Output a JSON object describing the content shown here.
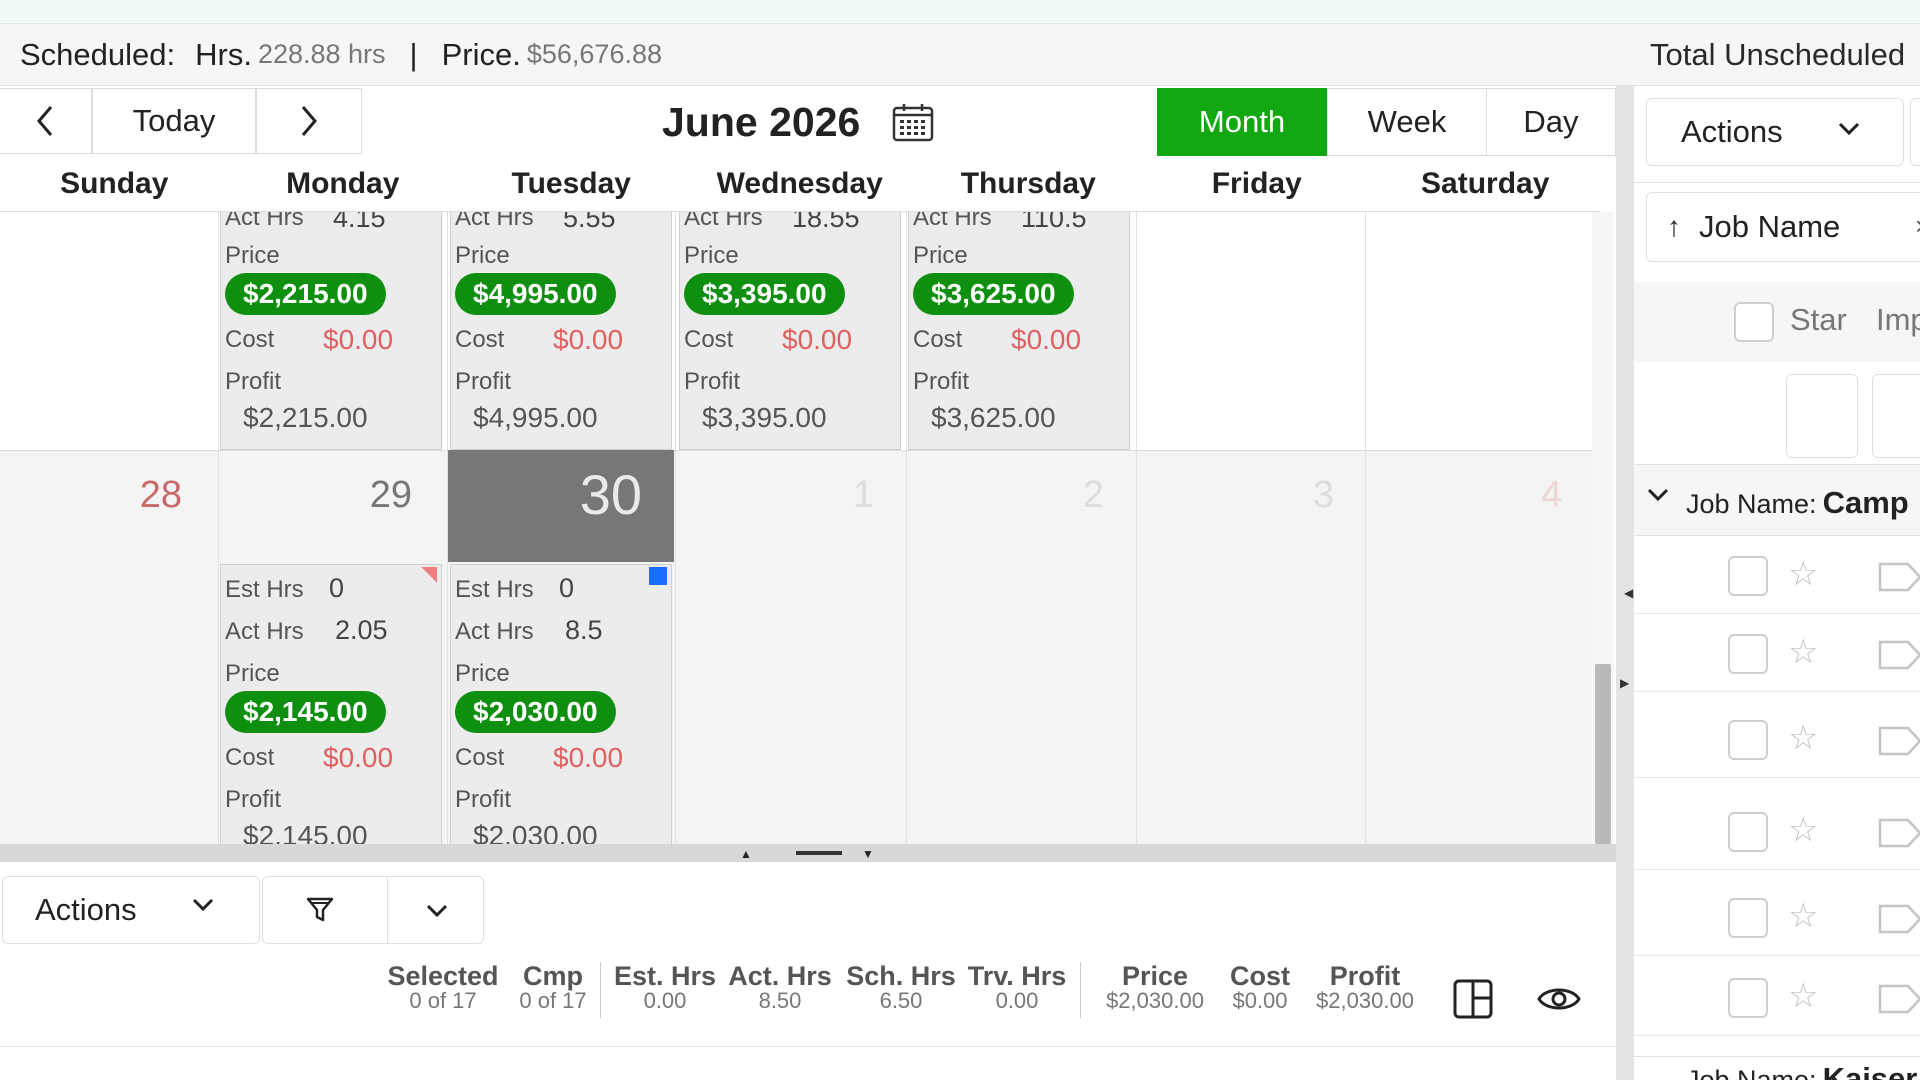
{
  "summary": {
    "scheduled_label": "Scheduled:",
    "hrs_label": "Hrs.",
    "hrs_value": "228.88 hrs",
    "separator": "|",
    "price_label": "Price.",
    "price_value": "$56,676.88",
    "total_unscheduled_label": "Total Unscheduled"
  },
  "calendar": {
    "today_label": "Today",
    "prev_icon": "chevron-left-icon",
    "next_icon": "chevron-right-icon",
    "title": "June 2026",
    "calendar_icon": "calendar-icon",
    "views": [
      "Month",
      "Week",
      "Day"
    ],
    "active_view": "Month",
    "weekdays": [
      "Sunday",
      "Monday",
      "Tuesday",
      "Wednesday",
      "Thursday",
      "Friday",
      "Saturday"
    ],
    "week1_cards": [
      {
        "act_hrs_label": "Act Hrs",
        "act_hrs": "4.15",
        "price_label": "Price",
        "price": "$2,215.00",
        "cost_label": "Cost",
        "cost": "$0.00",
        "profit_label": "Profit",
        "profit": "$2,215.00"
      },
      {
        "act_hrs_label": "Act Hrs",
        "act_hrs": "5.55",
        "price_label": "Price",
        "price": "$4,995.00",
        "cost_label": "Cost",
        "cost": "$0.00",
        "profit_label": "Profit",
        "profit": "$4,995.00"
      },
      {
        "act_hrs_label": "Act Hrs",
        "act_hrs": "18.55",
        "price_label": "Price",
        "price": "$3,395.00",
        "cost_label": "Cost",
        "cost": "$0.00",
        "profit_label": "Profit",
        "profit": "$3,395.00"
      },
      {
        "act_hrs_label": "Act Hrs",
        "act_hrs": "110.5",
        "price_label": "Price",
        "price": "$3,625.00",
        "cost_label": "Cost",
        "cost": "$0.00",
        "profit_label": "Profit",
        "profit": "$3,625.00"
      }
    ],
    "week2_days": [
      "28",
      "29",
      "30",
      "1",
      "2",
      "3",
      "4"
    ],
    "week2_cards": [
      {
        "est_hrs_label": "Est Hrs",
        "est_hrs": "0",
        "act_hrs_label": "Act Hrs",
        "act_hrs": "2.05",
        "price_label": "Price",
        "price": "$2,145.00",
        "cost_label": "Cost",
        "cost": "$0.00",
        "profit_label": "Profit",
        "profit": "$2,145.00"
      },
      {
        "est_hrs_label": "Est Hrs",
        "est_hrs": "0",
        "act_hrs_label": "Act Hrs",
        "act_hrs": "8.5",
        "price_label": "Price",
        "price": "$2,030.00",
        "cost_label": "Cost",
        "cost": "$0.00",
        "profit_label": "Profit",
        "profit": "$2,030.00"
      }
    ]
  },
  "bottom": {
    "actions_label": "Actions",
    "filter_icon": "filter-icon",
    "stats": [
      {
        "label": "Selected",
        "value": "0 of 17"
      },
      {
        "label": "Cmp",
        "value": "0 of 17"
      },
      {
        "label": "Est. Hrs",
        "value": "0.00"
      },
      {
        "label": "Act. Hrs",
        "value": "8.50"
      },
      {
        "label": "Sch. Hrs",
        "value": "6.50"
      },
      {
        "label": "Trv. Hrs",
        "value": "0.00"
      },
      {
        "label": "Price",
        "value": "$2,030.00"
      },
      {
        "label": "Cost",
        "value": "$0.00"
      },
      {
        "label": "Profit",
        "value": "$2,030.00"
      }
    ],
    "layout_icon": "layout-icon",
    "eye_icon": "eye-icon"
  },
  "right_panel": {
    "actions_label": "Actions",
    "sort_label": "Job Name",
    "sort_close": "×",
    "col_star": "Star",
    "col_imp": "Imp",
    "group_label": "Job Name:",
    "group_value": "Camp",
    "group2_label": "Job Name:",
    "group2_value": "Kaiser"
  },
  "colors": {
    "accent_green": "#11a811",
    "price_pill": "#0f8f0f",
    "cost_red": "#e06060",
    "today_bg": "#777777"
  }
}
